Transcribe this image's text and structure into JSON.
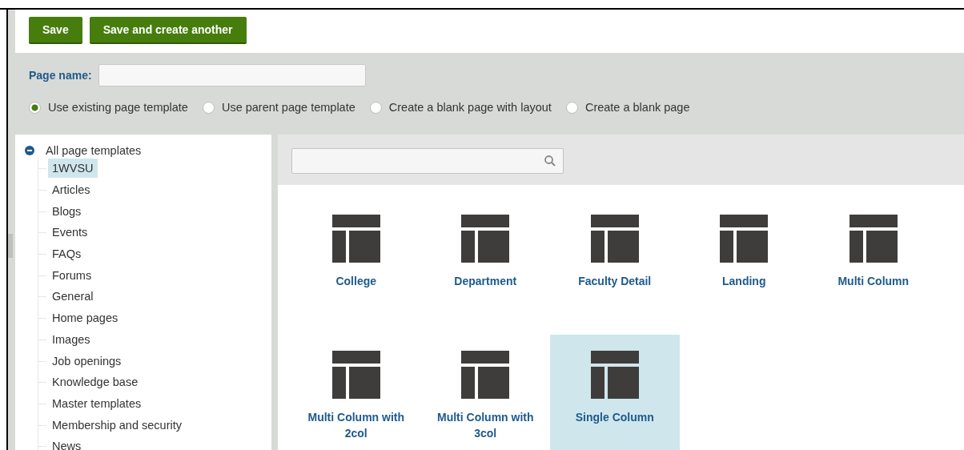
{
  "toolbar": {
    "buttons": [
      "Save",
      "Save and create another"
    ]
  },
  "page_name": {
    "label": "Page name:"
  },
  "template_options": [
    {
      "label": "Use existing page template",
      "selected": true
    },
    {
      "label": "Use parent page template",
      "selected": false
    },
    {
      "label": "Create a blank page with layout",
      "selected": false
    },
    {
      "label": "Create a blank page",
      "selected": false
    }
  ],
  "tree": {
    "label": "All page templates",
    "expanded": true,
    "children": [
      {
        "label": "1WVSU",
        "selected": true
      },
      {
        "label": "Articles",
        "selected": false
      },
      {
        "label": "Blogs",
        "selected": false
      },
      {
        "label": "Events",
        "selected": false
      },
      {
        "label": "FAQs",
        "selected": false
      },
      {
        "label": "Forums",
        "selected": false
      },
      {
        "label": "General",
        "selected": false
      },
      {
        "label": "Home pages",
        "selected": false
      },
      {
        "label": "Images",
        "selected": false
      },
      {
        "label": "Job openings",
        "selected": false
      },
      {
        "label": "Knowledge base",
        "selected": false
      },
      {
        "label": "Master templates",
        "selected": false
      },
      {
        "label": "Membership and security",
        "selected": false
      },
      {
        "label": "News",
        "selected": false
      }
    ]
  },
  "templates": [
    {
      "label": "College",
      "selected": false
    },
    {
      "label": "Department",
      "selected": false
    },
    {
      "label": "Faculty Detail",
      "selected": false
    },
    {
      "label": "Landing",
      "selected": false
    },
    {
      "label": "Multi Column",
      "selected": false
    },
    {
      "label": "Multi Column with 2col",
      "selected": false
    },
    {
      "label": "Multi Column with 3col",
      "selected": false
    },
    {
      "label": "Single Column",
      "selected": true
    }
  ]
}
